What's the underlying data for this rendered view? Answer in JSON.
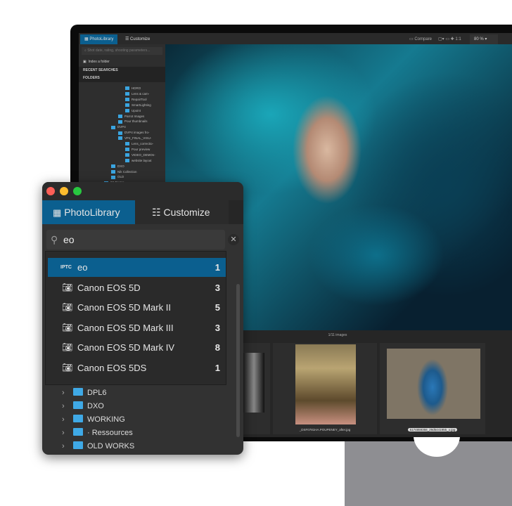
{
  "background_app": {
    "tabs": [
      "PhotoLibrary",
      "Customize"
    ],
    "toolbar": {
      "compare": "Compare",
      "ratio": "1:1",
      "zoom": "80 %"
    },
    "search_placeholder": "Shot date, rating, shooting parameters...",
    "index_folder": "Index a folder",
    "recent_searches": "RECENT SEARCHES",
    "folders": "FOLDERS",
    "tree": [
      "HDRO",
      "Lens & cam-",
      "RepairTool",
      "SmartLighting",
      "Upoint",
      "Parrot Images",
      "Pour thumbnails",
      "DVP4",
      "DVP4 images fro-",
      "VP4_FINAL_VISU-",
      "Lens_correctio-",
      "Pour preview",
      "VIDEO_DEMOs-",
      "website layout",
      "DXO",
      "Nik Collection",
      "OLD",
      "03-Textes"
    ],
    "filmstrip": {
      "count": "1/11 images",
      "files": [
        "_DSF0781HA.POUPENEY_after.jpg",
        "5174859358_29d5441955_o.jpg"
      ]
    }
  },
  "window": {
    "tabs": [
      {
        "label": "PhotoLibrary",
        "active": true
      },
      {
        "label": "Customize",
        "active": false
      }
    ],
    "search": {
      "value": "eo"
    },
    "suggestions": [
      {
        "badge": "IPTC",
        "label": "eo",
        "count": "1",
        "selected": true
      },
      {
        "label": "Canon EOS 5D",
        "count": "3"
      },
      {
        "label": "Canon EOS 5D Mark II",
        "count": "5"
      },
      {
        "label": "Canon EOS 5D Mark III",
        "count": "3"
      },
      {
        "label": "Canon EOS 5D Mark IV",
        "count": "8"
      },
      {
        "label": "Canon EOS 5DS",
        "count": "1"
      }
    ],
    "folders": [
      "DPL6",
      "DXO",
      "WORKING",
      "· Ressources",
      "OLD WORKS"
    ]
  },
  "colors": {
    "accent": "#0b5f8f",
    "folder": "#3fa9e6"
  }
}
